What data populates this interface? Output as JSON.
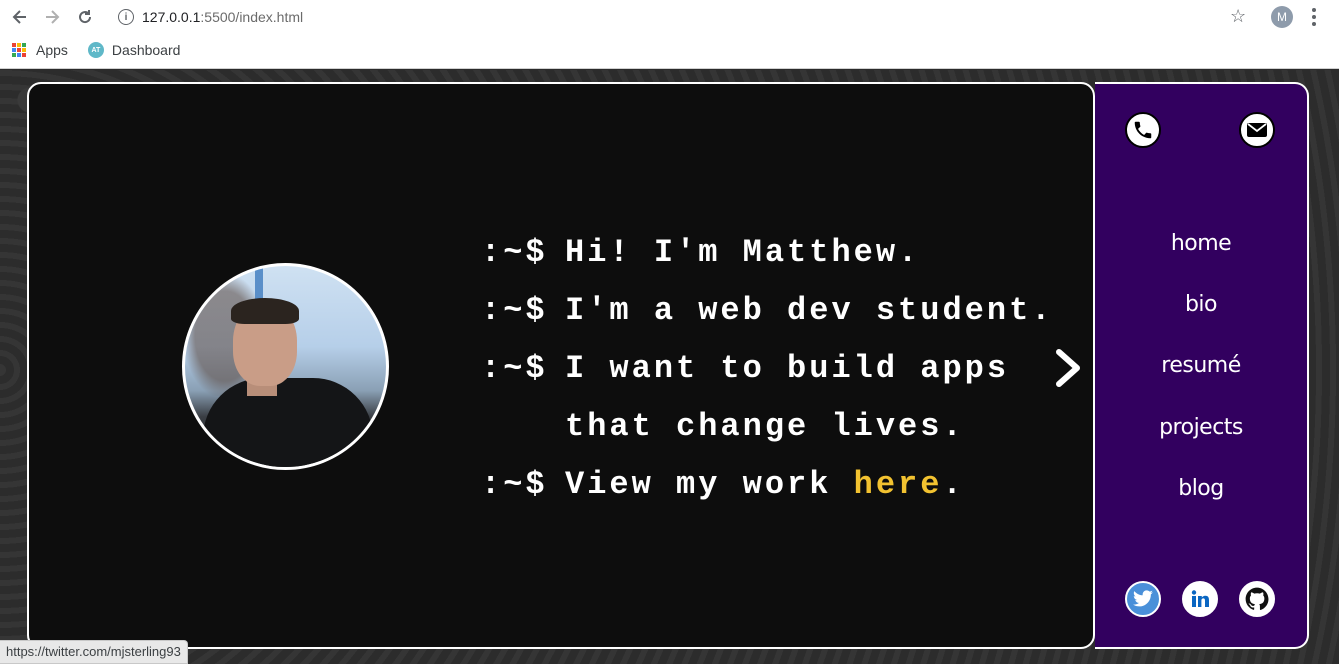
{
  "browser": {
    "url_host": "127.0.0.1",
    "url_path": ":5500/index.html",
    "profile_initial": "M",
    "bookmarks": [
      {
        "label": "Apps",
        "icon": "apps-grid-icon"
      },
      {
        "label": "Dashboard",
        "icon": "dashboard-favicon-icon"
      }
    ]
  },
  "terminal": {
    "prompt": ":~$",
    "lines": [
      {
        "text": "Hi! I'm Matthew."
      },
      {
        "text": "I'm a web dev student."
      },
      {
        "text": "I want to build apps"
      },
      {
        "text": "that change lives."
      }
    ],
    "last_line": {
      "before": "View my work ",
      "link": "here",
      "after": "."
    }
  },
  "sidebar": {
    "contact_icons": [
      "phone-icon",
      "mail-icon"
    ],
    "nav": [
      "home",
      "bio",
      "resumé",
      "projects",
      "blog"
    ],
    "social_icons": [
      "twitter-icon",
      "linkedin-icon",
      "github-icon"
    ]
  },
  "status_bar": {
    "text": "https://twitter.com/mjsterling93"
  },
  "colors": {
    "terminal_bg": "#0d0d0d",
    "sidebar_bg": "#32005f",
    "link": "#f2c230",
    "twitter": "#1da1f2",
    "linkedin": "#0077b5"
  }
}
